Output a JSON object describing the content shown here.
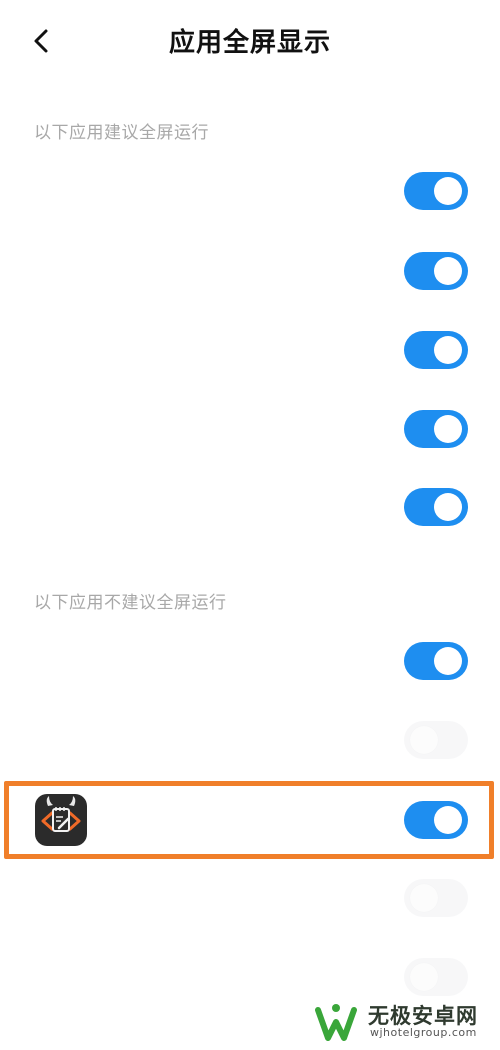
{
  "header": {
    "title": "应用全屏显示",
    "back_icon": "chevron-left-icon"
  },
  "sections": {
    "recommended_label": "以下应用建议全屏运行",
    "not_recommended_label": "以下应用不建议全屏运行"
  },
  "recommended_apps": [
    {
      "name": "",
      "enabled": true
    },
    {
      "name": "",
      "enabled": true
    },
    {
      "name": "",
      "enabled": true
    },
    {
      "name": "",
      "enabled": true
    },
    {
      "name": "",
      "enabled": true
    }
  ],
  "not_recommended_apps": [
    {
      "name": "",
      "enabled": true
    },
    {
      "name": "",
      "enabled": false
    },
    {
      "name": "",
      "enabled": true,
      "icon": "code-editor-app-icon",
      "highlighted": true
    },
    {
      "name": "",
      "enabled": false
    },
    {
      "name": "",
      "enabled": false
    }
  ],
  "colors": {
    "toggle_on": "#1e8ef0",
    "toggle_off": "#f1f2f4",
    "highlight": "#f07f2a",
    "section_label": "#a8a8a8"
  },
  "watermark": {
    "name": "无极安卓网",
    "url": "wjhotelgroup.com"
  }
}
